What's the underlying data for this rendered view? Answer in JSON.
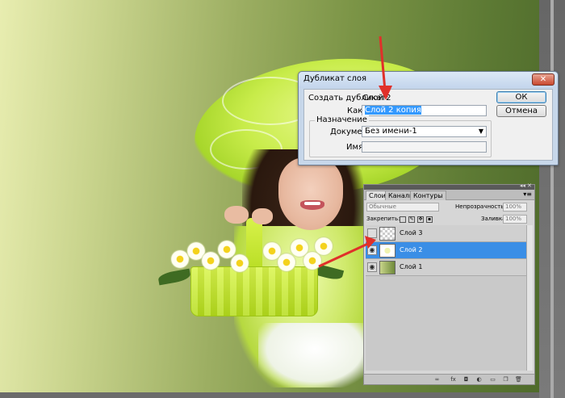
{
  "dialog": {
    "title": "Дубликат слоя",
    "close_label": "✕",
    "duplicate_label": "Создать дубликат:",
    "duplicate_value": "Слой 2",
    "as_label": "Как:",
    "as_value": "Слой 2 копия",
    "ok_label": "ОК",
    "cancel_label": "Отмена",
    "destination_legend": "Назначение",
    "document_label": "Документ:",
    "document_value": "Без имени-1",
    "name_label": "Имя:",
    "name_value": ""
  },
  "layers_panel": {
    "collapse_label": "◂◂ ✕",
    "tabs": [
      {
        "label": "Слои"
      },
      {
        "label": "Каналы"
      },
      {
        "label": "Контуры"
      }
    ],
    "menu_icon": "▾≡",
    "blend_mode": "Обычные",
    "opacity_label": "Непрозрачность:",
    "opacity_value": "100%",
    "lock_label": "Закрепить:",
    "fill_label": "Заливка:",
    "fill_value": "100%",
    "layers": [
      {
        "name": "Слой 3",
        "visible": false,
        "active": false
      },
      {
        "name": "Слой 2",
        "visible": true,
        "active": true
      },
      {
        "name": "Слой 1",
        "visible": true,
        "active": false
      }
    ]
  },
  "colors": {
    "selection": "#3a8ee6",
    "arrow": "#e0302a"
  }
}
